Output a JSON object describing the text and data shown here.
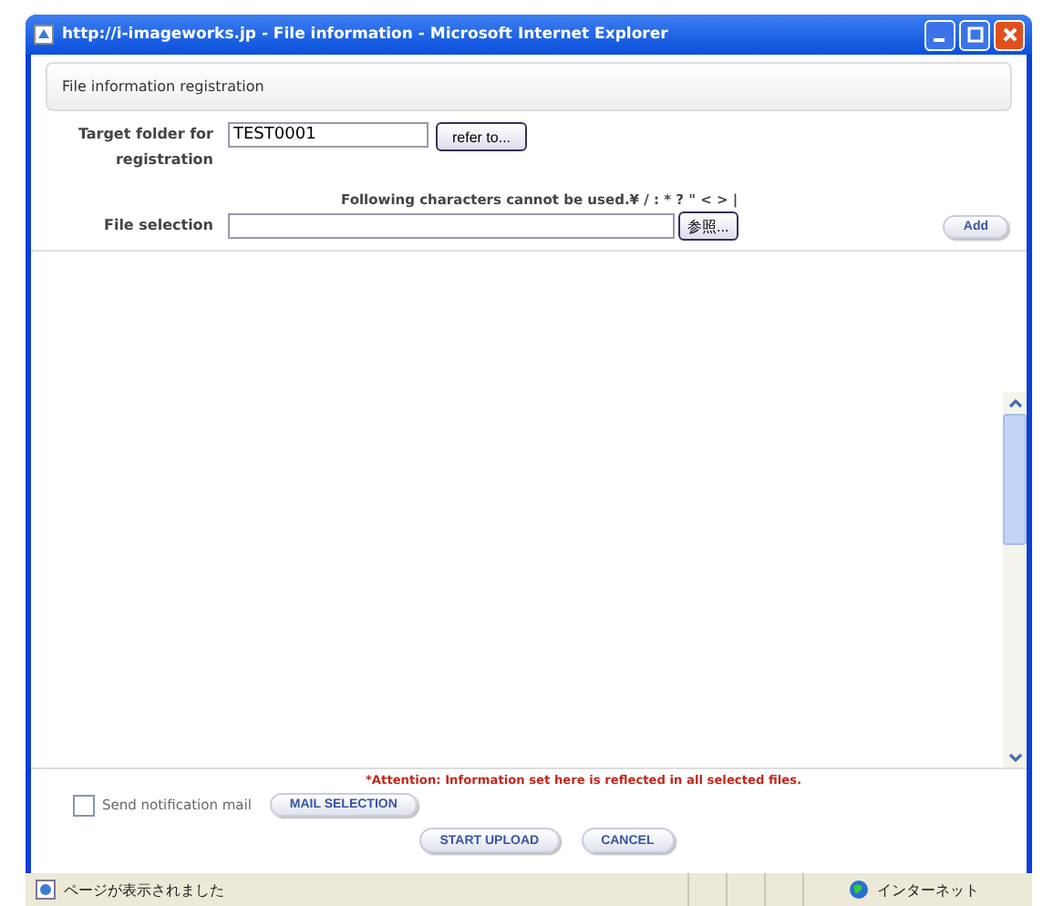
{
  "window": {
    "title": "http://i-imageworks.jp - File information - Microsoft Internet Explorer"
  },
  "section_title": "File information registration",
  "target_folder": {
    "label": "Target folder for registration",
    "value": "TEST0001",
    "button": "refer to..."
  },
  "notice": "Following characters cannot be used.¥ / : * ? \" < > |",
  "file_selection": {
    "label": "File selection",
    "browse_button": "参照...",
    "add_button": "Add"
  },
  "attention": "*Attention: Information set here is reflected in all selected files.",
  "notification": {
    "label": "Send notification mail",
    "checked": false,
    "button": "MAIL SELECTION"
  },
  "buttons": [
    "START UPLOAD",
    "CANCEL"
  ],
  "status_bar": {
    "text": "ページが表示されました",
    "zone": "インターネット"
  }
}
